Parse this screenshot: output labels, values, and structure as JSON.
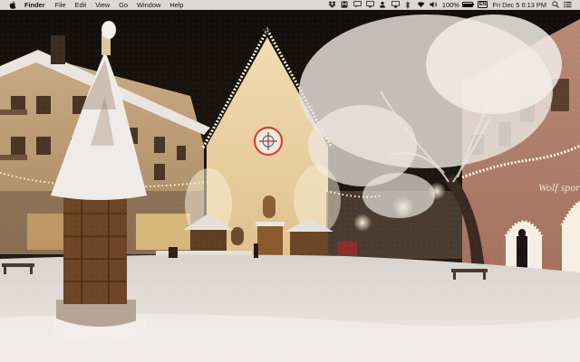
{
  "menubar": {
    "app_name": "Finder",
    "menus": [
      "File",
      "Edit",
      "View",
      "Go",
      "Window",
      "Help"
    ],
    "status": {
      "battery_percent": "100%",
      "input_source": "EN",
      "clock": "Fri Dec 5  6:13 PM"
    },
    "status_icons": [
      "dropbox-icon",
      "malwarebytes-icon",
      "message-icon",
      "display-icon",
      "user-icon",
      "screen-mirroring-icon",
      "bluetooth-icon",
      "wifi-icon",
      "volume-icon",
      "battery-icon",
      "keyboard-input-icon",
      "search-icon",
      "notification-list-icon"
    ]
  },
  "wallpaper": {
    "sign_text": "Wolf sport"
  }
}
